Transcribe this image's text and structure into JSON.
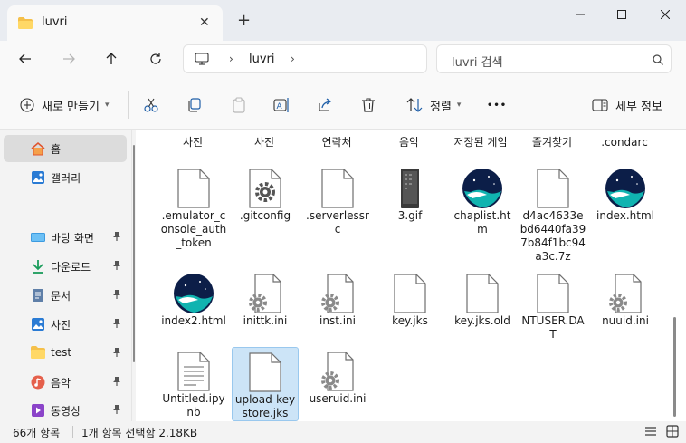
{
  "tab": {
    "title": "luvri",
    "close": "✕",
    "new_tab": "+"
  },
  "window": {
    "minimize": "minimize",
    "maximize": "maximize",
    "close": "close"
  },
  "address": {
    "crumb": "luvri",
    "sep": "›"
  },
  "search": {
    "placeholder": "luvri 검색"
  },
  "toolbar": {
    "new_label": "새로 만들기",
    "sort_label": "정렬",
    "more_label": "•••",
    "details_label": "세부 정보"
  },
  "sidebar": {
    "items": [
      {
        "label": "홈",
        "icon": "home-icon"
      },
      {
        "label": "갤러리",
        "icon": "gallery-icon"
      },
      {
        "label": "바탕 화면",
        "icon": "desktop-icon"
      },
      {
        "label": "다운로드",
        "icon": "download-icon"
      },
      {
        "label": "문서",
        "icon": "document-icon"
      },
      {
        "label": "사진",
        "icon": "picture-icon"
      },
      {
        "label": "test",
        "icon": "folder-icon"
      },
      {
        "label": "음악",
        "icon": "music-icon"
      },
      {
        "label": "동영상",
        "icon": "video-icon"
      }
    ]
  },
  "content": {
    "top_row": [
      "사진",
      "사진",
      "연락처",
      "음악",
      "저장된 게임",
      "즐겨찾기",
      ".condarc"
    ],
    "files": [
      {
        "name": ".emulator_console_auth_token",
        "icon": "blank"
      },
      {
        "name": ".gitconfig",
        "icon": "gear"
      },
      {
        "name": ".serverlessrc",
        "icon": "blank"
      },
      {
        "name": "3.gif",
        "icon": "gif"
      },
      {
        "name": "chaplist.htm",
        "icon": "whale"
      },
      {
        "name": "d4ac4633ebd6440fa397b84f1bc94a3c.7z",
        "icon": "blank"
      },
      {
        "name": "index.html",
        "icon": "whale"
      },
      {
        "name": "index2.html",
        "icon": "whale"
      },
      {
        "name": "inittk.ini",
        "icon": "ini"
      },
      {
        "name": "inst.ini",
        "icon": "ini"
      },
      {
        "name": "key.jks",
        "icon": "blank"
      },
      {
        "name": "key.jks.old",
        "icon": "blank"
      },
      {
        "name": "NTUSER.DAT",
        "icon": "blank"
      },
      {
        "name": "nuuid.ini",
        "icon": "ini"
      },
      {
        "name": "Untitled.ipynb",
        "icon": "text"
      },
      {
        "name": "upload-keystore.jks",
        "icon": "blank"
      },
      {
        "name": "useruid.ini",
        "icon": "ini"
      }
    ]
  },
  "status": {
    "count": "66개 항목",
    "selection": "1개 항목 선택함 2.18KB"
  },
  "colors": {
    "accent": "#0067c0",
    "selection": "#cce4f7",
    "folder": "#f5c04a",
    "whale": "#0fa3a8"
  }
}
